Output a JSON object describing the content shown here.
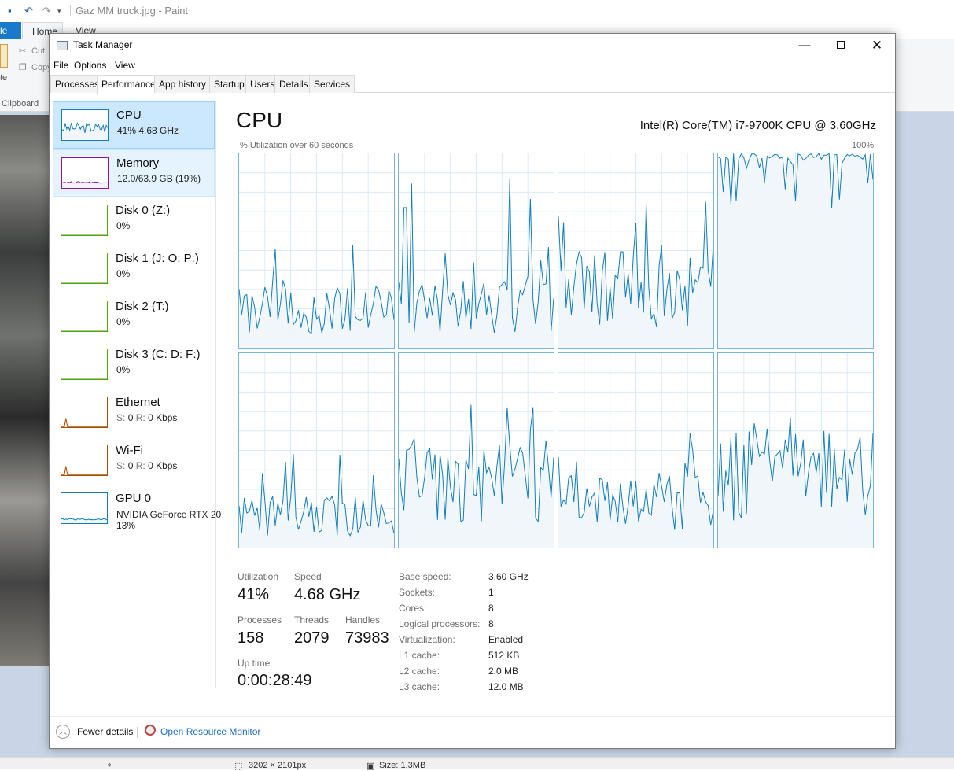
{
  "paint": {
    "title": "Gaz MM truck.jpg - Paint",
    "file_tab": "le",
    "home_tab": "Home",
    "view_tab": "View",
    "cut_label": "Cut",
    "copy_label": "Copy",
    "paste_label": "te",
    "clipboard_label": "Clipboard",
    "status_size": "3202 × 2101px",
    "status_filesize": "Size: 1.3MB"
  },
  "window": {
    "title": "Task Manager",
    "minimize": "—",
    "close": "✕"
  },
  "menu": [
    "File",
    "Options",
    "View"
  ],
  "tabs": [
    "Processes",
    "Performance",
    "App history",
    "Startup",
    "Users",
    "Details",
    "Services"
  ],
  "active_tab": "Performance",
  "sidebar": [
    {
      "name": "CPU",
      "sub": "41%  4.68 GHz",
      "color": "#117dbb",
      "fill": "#f1f6fa",
      "util": 0.41
    },
    {
      "name": "Memory",
      "sub": "12.0/63.9 GB (19%)",
      "color": "#8b12ae",
      "fill": "#f4f2f4",
      "util": 0.19
    },
    {
      "name": "Disk 0 (Z:)",
      "sub": "0%",
      "color": "#4da60c",
      "fill": "#eff4ea",
      "util": 0
    },
    {
      "name": "Disk 1 (J: O: P:)",
      "sub": "0%",
      "color": "#4da60c",
      "fill": "#eff4ea",
      "util": 0
    },
    {
      "name": "Disk 2 (T:)",
      "sub": "0%",
      "color": "#4da60c",
      "fill": "#eff4ea",
      "util": 0
    },
    {
      "name": "Disk 3 (C: D: F:)",
      "sub": "0%",
      "color": "#4da60c",
      "fill": "#eff4ea",
      "util": 0
    },
    {
      "name": "Ethernet",
      "sub_s": "S:",
      "sub_s_val": "0",
      "sub_r": "R:",
      "sub_r_val": "0 Kbps",
      "color": "#a74f01",
      "fill": "#fcf3eb",
      "util": 0
    },
    {
      "name": "Wi-Fi",
      "sub_s": "S:",
      "sub_s_val": "0",
      "sub_r": "R:",
      "sub_r_val": "0 Kbps",
      "color": "#a74f01",
      "fill": "#fcf3eb",
      "util": 0
    },
    {
      "name": "GPU 0",
      "sub": "NVIDIA GeForce RTX 20",
      "sub2": "13%",
      "color": "#117dbb",
      "fill": "#f1f6fa",
      "util": 0.13
    }
  ],
  "main": {
    "heading": "CPU",
    "model": "Intel(R) Core(TM) i7-9700K CPU @ 3.60GHz",
    "graph_caption": "% Utilization over 60 seconds",
    "graph_max": "100%",
    "graph_color": "#117dbb",
    "graph_fill": "#f1f6fa",
    "cores": [
      {
        "core": 1,
        "mean": 0.18,
        "spike": 0.55
      },
      {
        "core": 2,
        "mean": 0.2,
        "spike": 0.95
      },
      {
        "core": 3,
        "mean": 0.28,
        "spike": 0.8
      },
      {
        "core": 4,
        "mean": 0.92,
        "spike": 0.99
      },
      {
        "core": 5,
        "mean": 0.15,
        "spike": 0.5
      },
      {
        "core": 6,
        "mean": 0.3,
        "spike": 0.75
      },
      {
        "core": 7,
        "mean": 0.22,
        "spike": 0.62
      },
      {
        "core": 8,
        "mean": 0.35,
        "spike": 0.78
      }
    ]
  },
  "stats": {
    "utilization_label": "Utilization",
    "utilization": "41%",
    "speed_label": "Speed",
    "speed": "4.68 GHz",
    "processes_label": "Processes",
    "processes": "158",
    "threads_label": "Threads",
    "threads": "2079",
    "handles_label": "Handles",
    "handles": "73983",
    "uptime_label": "Up time",
    "uptime": "0:00:28:49"
  },
  "specs": [
    {
      "label": "Base speed:",
      "value": "3.60 GHz"
    },
    {
      "label": "Sockets:",
      "value": "1"
    },
    {
      "label": "Cores:",
      "value": "8"
    },
    {
      "label": "Logical processors:",
      "value": "8"
    },
    {
      "label": "Virtualization:",
      "value": "Enabled"
    },
    {
      "label": "L1 cache:",
      "value": "512 KB"
    },
    {
      "label": "L2 cache:",
      "value": "2.0 MB"
    },
    {
      "label": "L3 cache:",
      "value": "12.0 MB"
    }
  ],
  "footer": {
    "fewer_details": "Fewer details",
    "resource_monitor": "Open Resource Monitor"
  }
}
